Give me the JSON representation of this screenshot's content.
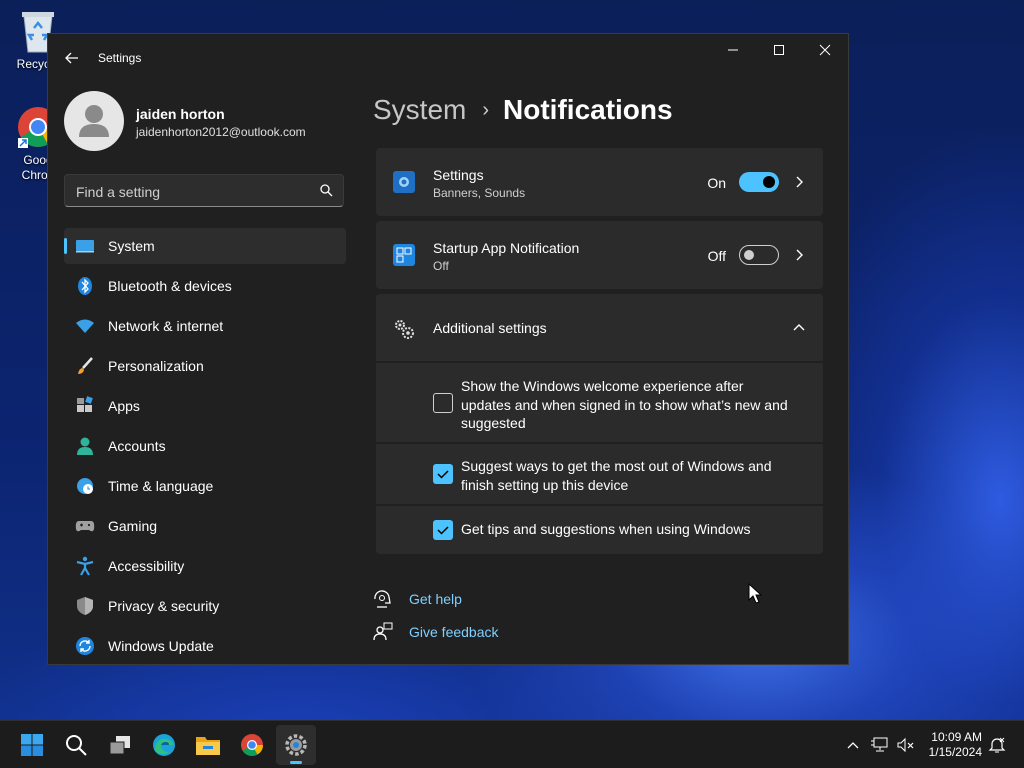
{
  "desktop": {
    "icons": [
      {
        "label": "Recycle"
      },
      {
        "label": "Goog\nChron"
      }
    ]
  },
  "window": {
    "title": "Settings",
    "controls": {
      "minimize": "minimize",
      "maximize": "maximize",
      "close": "close"
    }
  },
  "profile": {
    "name": "jaiden horton",
    "email": "jaidenhorton2012@outlook.com"
  },
  "search": {
    "placeholder": "Find a setting"
  },
  "sidebar": {
    "items": [
      {
        "label": "System",
        "icon": "system-icon",
        "active": true
      },
      {
        "label": "Bluetooth & devices",
        "icon": "bluetooth-icon"
      },
      {
        "label": "Network & internet",
        "icon": "wifi-icon"
      },
      {
        "label": "Personalization",
        "icon": "brush-icon"
      },
      {
        "label": "Apps",
        "icon": "apps-icon"
      },
      {
        "label": "Accounts",
        "icon": "accounts-icon"
      },
      {
        "label": "Time & language",
        "icon": "globe-clock-icon"
      },
      {
        "label": "Gaming",
        "icon": "gamepad-icon"
      },
      {
        "label": "Accessibility",
        "icon": "accessibility-icon"
      },
      {
        "label": "Privacy & security",
        "icon": "shield-icon"
      },
      {
        "label": "Windows Update",
        "icon": "update-icon"
      }
    ]
  },
  "breadcrumb": {
    "parent": "System",
    "separator": "›",
    "current": "Notifications"
  },
  "main": {
    "notifications_card": {
      "title": "Settings",
      "subtitle": "Banners, Sounds",
      "state": "On",
      "toggle_on": true
    },
    "startup_card": {
      "title": "Startup App Notification",
      "subtitle": "Off",
      "state": "Off",
      "toggle_on": false
    },
    "additional": {
      "title": "Additional settings",
      "expanded": true,
      "options": [
        {
          "label": "Show the Windows welcome experience after updates and when signed in to show what’s new and suggested",
          "checked": false
        },
        {
          "label": "Suggest ways to get the most out of Windows and finish setting up this device",
          "checked": true
        },
        {
          "label": "Get tips and suggestions when using Windows",
          "checked": true
        }
      ]
    },
    "links": {
      "help": "Get help",
      "feedback": "Give feedback"
    }
  },
  "taskbar": {
    "apps": [
      "start-icon",
      "search-icon",
      "task-view-icon",
      "edge-icon",
      "file-explorer-icon",
      "chrome-icon",
      "settings-icon"
    ],
    "active_app": "settings-icon",
    "clock": {
      "time": "10:09 AM",
      "date": "1/15/2024"
    }
  },
  "colors": {
    "accent": "#4cc2ff",
    "window_bg": "#202020",
    "card_bg": "#2b2b2b"
  }
}
